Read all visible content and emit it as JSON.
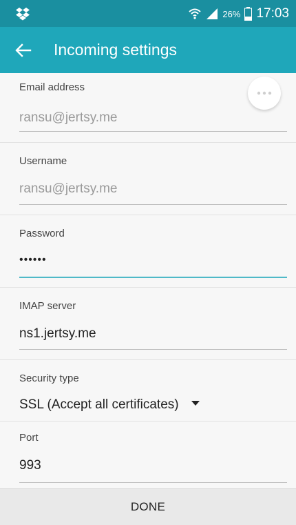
{
  "status_bar": {
    "battery_percent": "26%",
    "time": "17:03",
    "icons": [
      "dropbox-icon",
      "wifi-icon",
      "signal-icon",
      "battery-icon"
    ]
  },
  "app_bar": {
    "title": "Incoming settings",
    "back_icon": "arrow-back-icon"
  },
  "fields": {
    "email": {
      "label": "Email address",
      "value": "ransu@jertsy.me"
    },
    "username": {
      "label": "Username",
      "value": "ransu@jertsy.me"
    },
    "password": {
      "label": "Password",
      "value": "••••••"
    },
    "imap_server": {
      "label": "IMAP server",
      "value": "ns1.jertsy.me"
    },
    "security_type": {
      "label": "Security type",
      "value": "SSL (Accept all certificates)"
    },
    "port": {
      "label": "Port",
      "value": "993"
    }
  },
  "footer": {
    "done_label": "DONE"
  },
  "colors": {
    "status_bar": "#1a8fa0",
    "app_bar": "#1fa7ba",
    "focus_line": "#4fb9c8"
  }
}
